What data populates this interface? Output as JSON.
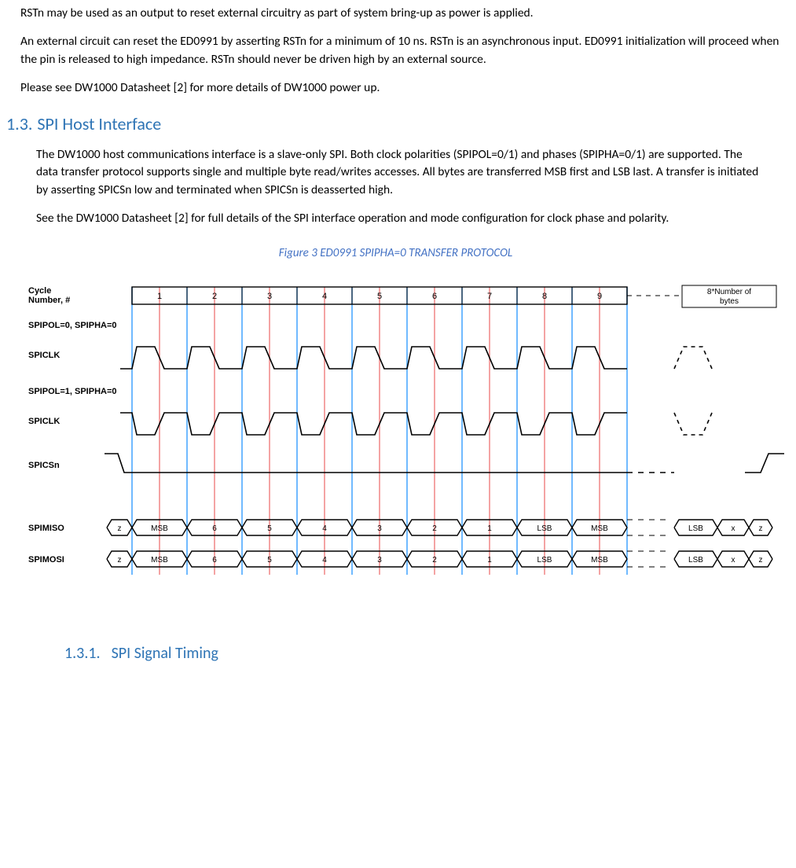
{
  "paragraphs": {
    "p1": "RSTn may be used as an output to reset external circuitry as part of system bring-up as power is applied.",
    "p2": "An external circuit can reset the ED0991 by asserting RSTn for a minimum of 10 ns. RSTn is an asynchronous input. ED0991 initialization will proceed when the pin is released to high impedance. RSTn should never be driven high by an external source.",
    "p3": "Please see DW1000 Datasheet [2] for more details of DW1000 power up.",
    "p4": "The DW1000 host communications interface is a slave-only SPI.  Both clock polarities (SPIPOL=0/1) and phases   (SPIPHA=0/1) are supported.  The data transfer protocol supports single and multiple byte read/writes accesses.   All bytes are transferred MSB first and LSB last.  A transfer is initiated by asserting SPICSn low and terminated   when SPICSn is deasserted high.",
    "p5": "See the DW1000 Datasheet [2] for full details of the SPI interface operation and mode configuration for clock phase and polarity."
  },
  "headings": {
    "sec_num": "1.3.",
    "sec_title": "SPI Host Interface",
    "subsec_num": "1.3.1.",
    "subsec_title": "SPI Signal Timing"
  },
  "figure": {
    "caption": "Figure 3 ED0991 SPIPHA=0 TRANSFER PROTOCOL",
    "labels": {
      "cycle": "Cycle\nNumber, #",
      "pol0": "SPIPOL=0, SPIPHA=0",
      "clk1": "SPICLK",
      "pol1": "SPIPOL=1, SPIPHA=0",
      "clk2": "SPICLK",
      "csn": "SPICSn",
      "miso": "SPIMISO",
      "mosi": "SPIMOSI",
      "corner": "8*Number of bytes"
    },
    "cycle_numbers": [
      "1",
      "2",
      "3",
      "4",
      "5",
      "6",
      "7",
      "8",
      "9"
    ],
    "data_cells_main": [
      "z",
      "MSB",
      "6",
      "5",
      "4",
      "3",
      "2",
      "1",
      "LSB",
      "MSB"
    ],
    "data_cells_tail": [
      "LSB",
      "x",
      "z"
    ]
  }
}
